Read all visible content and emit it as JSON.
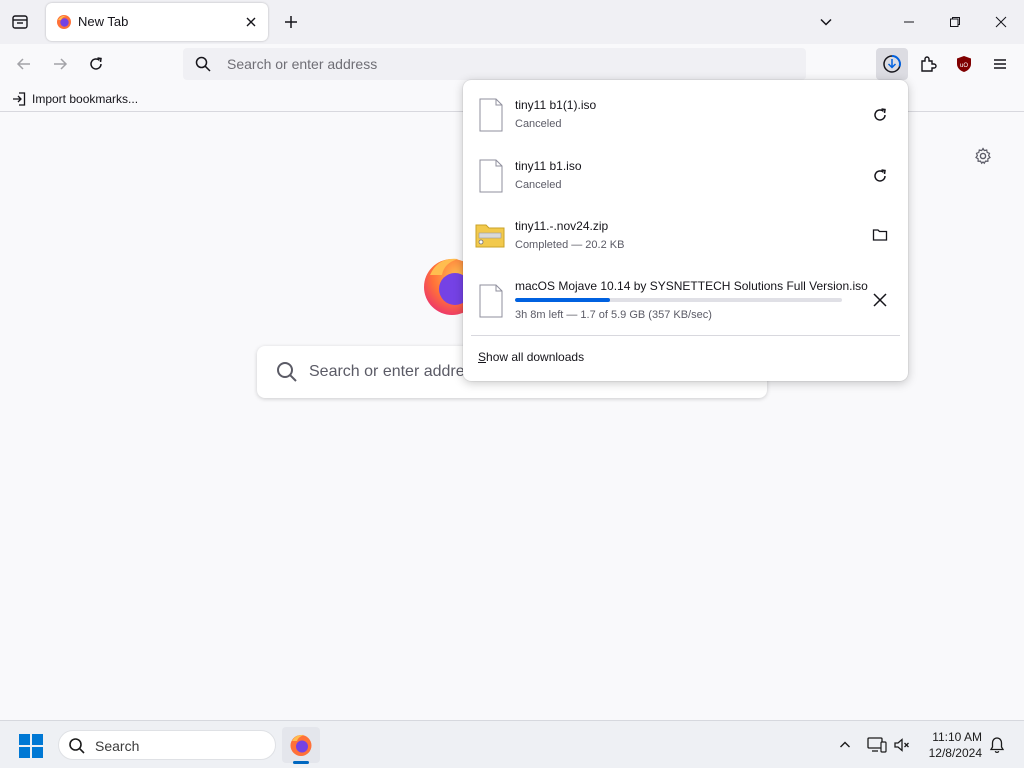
{
  "browser": {
    "tab": {
      "title": "New Tab"
    },
    "urlbar": {
      "placeholder": "Search or enter address"
    },
    "bookmarks": {
      "import_label": "Import bookmarks..."
    }
  },
  "newtab": {
    "search_placeholder": "Search or enter address"
  },
  "downloads": {
    "items": [
      {
        "name": "tiny11 b1(1).iso",
        "status": "Canceled",
        "icon": "file-icon",
        "action": "retry-icon"
      },
      {
        "name": "tiny11 b1.iso",
        "status": "Canceled",
        "icon": "file-icon",
        "action": "retry-icon"
      },
      {
        "name": "tiny11.-.nov24.zip",
        "status": "Completed — 20.2 KB",
        "icon": "zip-folder-icon",
        "action": "show-in-folder-icon"
      },
      {
        "name": "macOS Mojave 10.14 by SYSNETTECH Solutions Full Version.iso",
        "status": "3h 8m left — 1.7 of 5.9 GB (357 KB/sec)",
        "icon": "file-icon",
        "action": "cancel-icon",
        "progress_fraction": 0.29
      }
    ],
    "show_all": {
      "access_key": "S",
      "rest": "how all downloads"
    }
  },
  "taskbar": {
    "search_label": "Search",
    "time": "11:10 AM",
    "date": "12/8/2024"
  },
  "colors": {
    "accent": "#0061e0",
    "ublock": "#800000",
    "folder": "#f2c94c"
  }
}
